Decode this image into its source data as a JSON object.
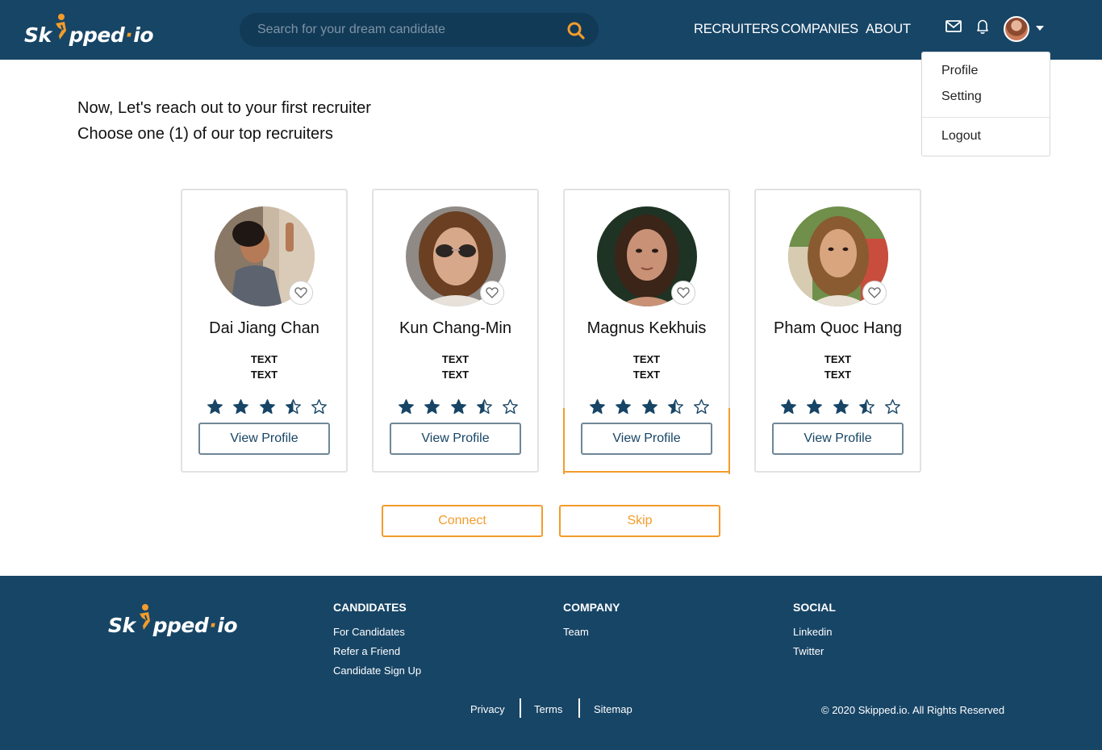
{
  "brand": {
    "name_left": "Sk",
    "name_right": "pped",
    "name_suffix": "io",
    "dot": "·"
  },
  "colors": {
    "navy": "#174566",
    "orange": "#f39c2b",
    "star": "#174566"
  },
  "search": {
    "placeholder": "Search for your dream candidate",
    "icon": "search-icon"
  },
  "nav": {
    "items": [
      "RECRUITERS",
      "COMPANIES",
      "ABOUT"
    ],
    "icons": [
      "mail-icon",
      "bell-icon",
      "avatar",
      "caret-down-icon"
    ]
  },
  "dropdown": {
    "items": [
      "Profile",
      "Setting",
      "Logout"
    ]
  },
  "intro": {
    "line1": "Now, Let's reach out to your first recruiter",
    "line2": "Choose one (1) of our top recruiters"
  },
  "recruiters": [
    {
      "name": "Dai Jiang Chan",
      "text1": "TEXT",
      "text2": "TEXT",
      "rating": 3.5,
      "button": "View Profile"
    },
    {
      "name": "Kun Chang-Min",
      "text1": "TEXT",
      "text2": "TEXT",
      "rating": 3.5,
      "button": "View Profile"
    },
    {
      "name": "Magnus Kekhuis",
      "text1": "TEXT",
      "text2": "TEXT",
      "rating": 3.5,
      "button": "View Profile",
      "selected": true
    },
    {
      "name": "Pham Quoc Hang",
      "text1": "TEXT",
      "text2": "TEXT",
      "rating": 3.5,
      "button": "View Profile"
    }
  ],
  "actions": {
    "connect": "Connect",
    "skip": "Skip"
  },
  "footer": {
    "candidates": {
      "heading": "CANDIDATES",
      "links": [
        "For Candidates",
        "Refer a Friend",
        "Candidate Sign Up"
      ]
    },
    "company": {
      "heading": "COMPANY",
      "links": [
        "Team"
      ]
    },
    "social": {
      "heading": "SOCIAL",
      "links": [
        "Linkedin",
        "Twitter"
      ]
    },
    "legal": [
      "Privacy",
      "Terms",
      "Sitemap"
    ],
    "copyright": "© 2020 Skipped.io. All Rights Reserved"
  }
}
